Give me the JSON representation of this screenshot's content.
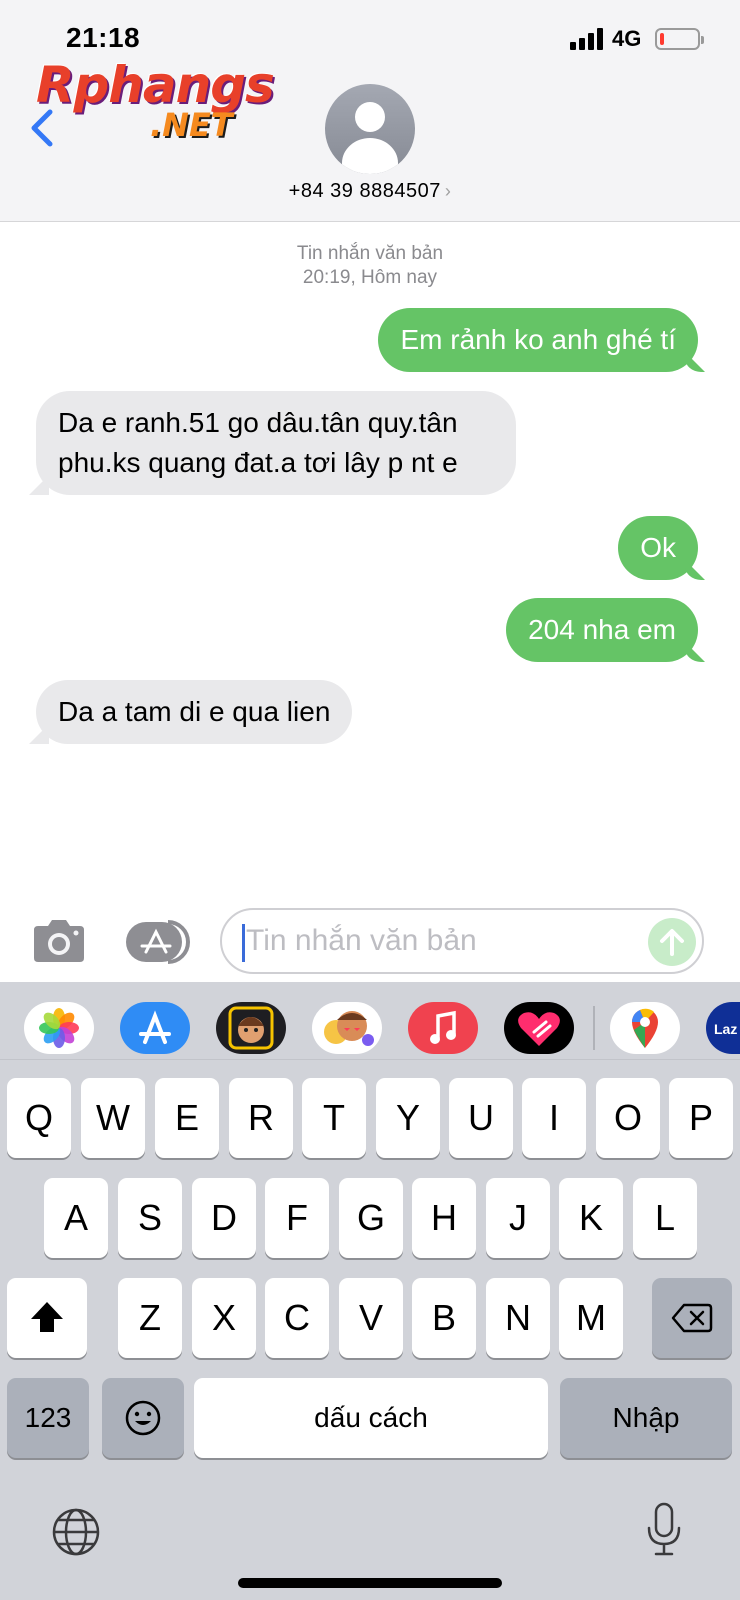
{
  "status_bar": {
    "time": "21:18",
    "network": "4G"
  },
  "header": {
    "logo": {
      "main": "Rphangs",
      "suffix": ".NET"
    },
    "contact": "+84 39 8884507",
    "chevron": "›"
  },
  "thread": {
    "meta_type": "Tin nhắn văn bản",
    "meta_time": "20:19, Hôm nay",
    "messages": [
      {
        "direction": "sent",
        "text": "Em rảnh ko anh ghé tí"
      },
      {
        "direction": "received",
        "text": "Da e ranh.51 go dâu.tân quy.tân phu.ks quang đat.a tơi lây p nt e"
      },
      {
        "direction": "sent",
        "text": "Ok"
      },
      {
        "direction": "sent",
        "text": "204 nha em"
      },
      {
        "direction": "received",
        "text": "Da a tam di e qua lien"
      }
    ]
  },
  "composer": {
    "placeholder": "Tin nhắn văn bản"
  },
  "app_strip": [
    "photos-icon",
    "app-store-icon",
    "memoji-icon",
    "animoji-stickers-icon",
    "music-icon",
    "digital-touch-icon",
    "google-maps-icon",
    "lazada-icon"
  ],
  "keyboard": {
    "row1": [
      "Q",
      "W",
      "E",
      "R",
      "T",
      "Y",
      "U",
      "I",
      "O",
      "P"
    ],
    "row2": [
      "A",
      "S",
      "D",
      "F",
      "G",
      "H",
      "J",
      "K",
      "L"
    ],
    "row3": [
      "Z",
      "X",
      "C",
      "V",
      "B",
      "N",
      "M"
    ],
    "numbers": "123",
    "space": "dấu cách",
    "return": "Nhập"
  },
  "colors": {
    "sent_bubble": "#65c466",
    "received_bubble": "#e9e9eb",
    "accent": "#3478f6"
  }
}
